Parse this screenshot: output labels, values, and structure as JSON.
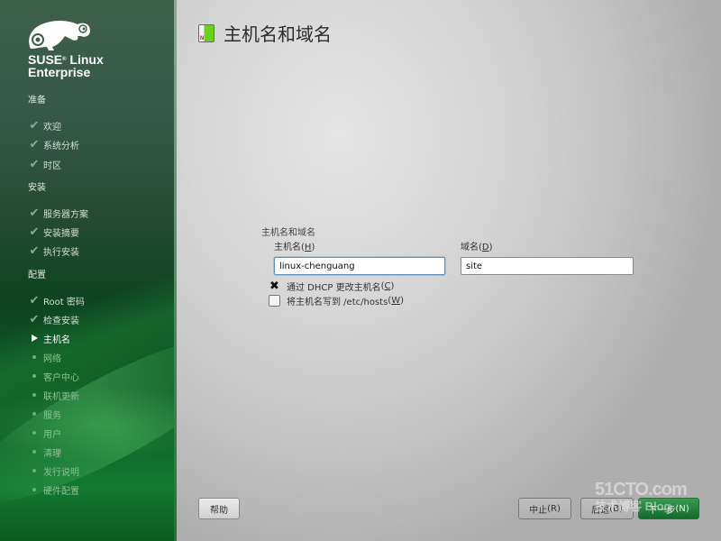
{
  "sidebar": {
    "brand_line1": "SUSE",
    "brand_reg": "®",
    "brand_line1b": " Linux",
    "brand_line2": "Enterprise",
    "sections": [
      {
        "title": "准备",
        "steps": [
          {
            "label": "欢迎",
            "status": "done"
          },
          {
            "label": "系统分析",
            "status": "done"
          },
          {
            "label": "时区",
            "status": "done"
          }
        ]
      },
      {
        "title": "安装",
        "steps": [
          {
            "label": "服务器方案",
            "status": "done"
          },
          {
            "label": "安装摘要",
            "status": "done"
          },
          {
            "label": "执行安装",
            "status": "done"
          }
        ]
      },
      {
        "title": "配置",
        "steps": [
          {
            "label": "Root 密码",
            "status": "done"
          },
          {
            "label": "检查安装",
            "status": "done"
          },
          {
            "label": "主机名",
            "status": "current"
          },
          {
            "label": "网络",
            "status": "todo"
          },
          {
            "label": "客户中心",
            "status": "todo"
          },
          {
            "label": "联机更新",
            "status": "todo"
          },
          {
            "label": "服务",
            "status": "todo"
          },
          {
            "label": "用户",
            "status": "todo"
          },
          {
            "label": "清理",
            "status": "todo"
          },
          {
            "label": "发行说明",
            "status": "todo"
          },
          {
            "label": "硬件配置",
            "status": "todo"
          }
        ]
      }
    ]
  },
  "main": {
    "title": "主机名和域名",
    "title_icon_letter": "N",
    "group_label": "主机名和域名",
    "hostname": {
      "label": "主机名",
      "mnemonic": "H",
      "value": "linux-chenguang"
    },
    "domain": {
      "label": "域名",
      "mnemonic": "D",
      "value": "site"
    },
    "dhcp_checkbox": {
      "label": "通过 DHCP 更改主机名",
      "mnemonic": "C",
      "checked": true
    },
    "hosts_checkbox": {
      "label": "将主机名写到 /etc/hosts",
      "mnemonic": "W",
      "checked": false
    }
  },
  "buttons": {
    "help": "帮助",
    "abort": "中止",
    "abort_key": "R",
    "back": "后退",
    "back_key": "B",
    "next": "下一步",
    "next_key": "N"
  },
  "watermark": {
    "line1": "51CTO.com",
    "line2": "技术博客 Blog"
  }
}
